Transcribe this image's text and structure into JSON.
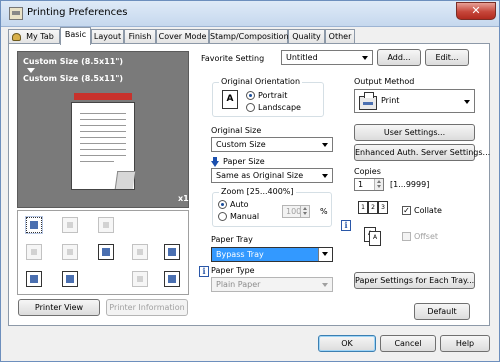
{
  "window": {
    "title": "Printing Preferences",
    "close_label": "✕"
  },
  "tabs": [
    {
      "label": "My Tab",
      "active": false
    },
    {
      "label": "Basic",
      "active": true
    },
    {
      "label": "Layout",
      "active": false
    },
    {
      "label": "Finish",
      "active": false
    },
    {
      "label": "Cover Mode",
      "active": false
    },
    {
      "label": "Stamp/Composition",
      "active": false
    },
    {
      "label": "Quality",
      "active": false
    },
    {
      "label": "Other",
      "active": false
    }
  ],
  "preview": {
    "line1": "Custom Size (8.5x11\")",
    "line2": "Custom Size (8.5x11\")",
    "count": "x1",
    "printer_view_label": "Printer View",
    "printer_info_label": "Printer Information"
  },
  "favorite": {
    "label": "Favorite Setting",
    "value": "Untitled",
    "add_label": "Add...",
    "edit_label": "Edit..."
  },
  "orientation": {
    "group_label": "Original Orientation",
    "portrait_label": "Portrait",
    "landscape_label": "Landscape",
    "selected": "Portrait",
    "icon_glyph": "A"
  },
  "original_size": {
    "label": "Original Size",
    "value": "Custom Size"
  },
  "paper_size": {
    "label": "Paper Size",
    "value": "Same as Original Size"
  },
  "zoom": {
    "group_label": "Zoom [25...400%]",
    "auto_label": "Auto",
    "manual_label": "Manual",
    "selected": "Auto",
    "value": "100",
    "unit": "%"
  },
  "paper_tray": {
    "label": "Paper Tray",
    "value": "Bypass Tray"
  },
  "paper_type": {
    "label": "Paper Type",
    "value": "Plain Paper"
  },
  "output_method": {
    "label": "Output Method",
    "value": "Print"
  },
  "buttons": {
    "user_settings": "User Settings...",
    "enhanced_auth": "Enhanced Auth. Server Settings...",
    "paper_settings_each_tray": "Paper Settings for Each Tray...",
    "default": "Default",
    "ok": "OK",
    "cancel": "Cancel",
    "help": "Help"
  },
  "copies": {
    "label": "Copies",
    "value": "1",
    "range": "[1...9999]",
    "collate_label": "Collate",
    "collate_checked": true,
    "offset_label": "Offset",
    "offset_checked": false
  },
  "info_glyph": "i"
}
